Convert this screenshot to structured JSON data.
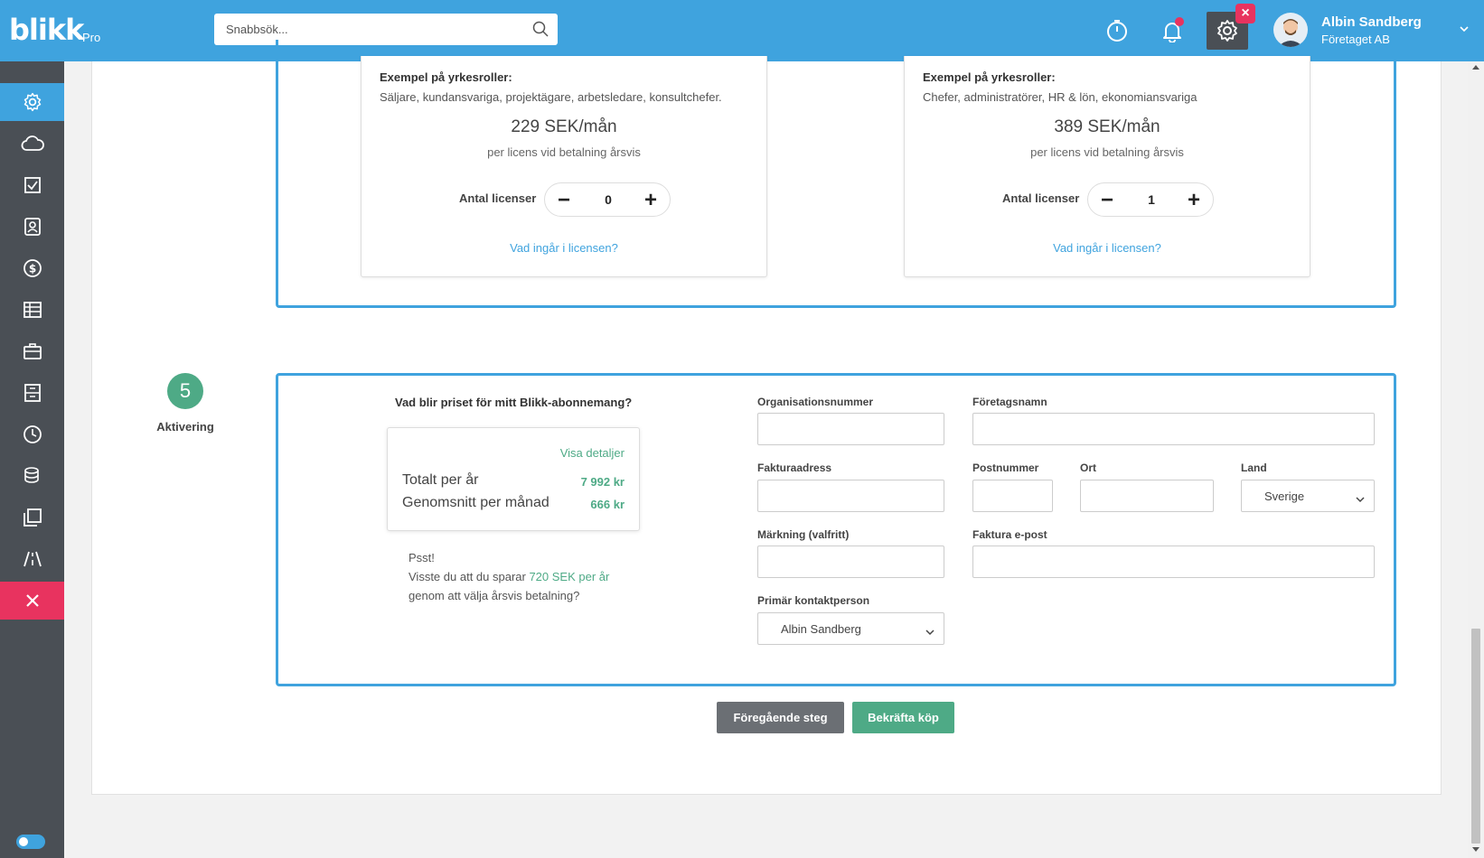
{
  "header": {
    "logo": "blikk",
    "logo_suffix": "Pro",
    "search_placeholder": "Snabbsök...",
    "user_name": "Albin Sandberg",
    "user_company": "Företaget AB",
    "colors": {
      "primary": "#3fa3de",
      "accent": "#e8335f",
      "success": "#4eaa86",
      "sidebar": "#4a4f55"
    }
  },
  "sidebar": {
    "items": [
      {
        "icon": "gear-icon",
        "active": true
      },
      {
        "icon": "cloud-icon"
      },
      {
        "icon": "checkbox-icon"
      },
      {
        "icon": "contacts-icon"
      },
      {
        "icon": "dollar-icon"
      },
      {
        "icon": "table-icon"
      },
      {
        "icon": "briefcase-icon"
      },
      {
        "icon": "archive-icon"
      },
      {
        "icon": "clock-icon"
      },
      {
        "icon": "coins-icon"
      },
      {
        "icon": "copy-icon"
      },
      {
        "icon": "road-icon"
      },
      {
        "icon": "close-icon"
      }
    ]
  },
  "licenses": [
    {
      "roles_title": "Exempel på yrkesroller:",
      "roles_text": "Säljare, kundansvariga, projektägare, arbetsledare, konsultchefer.",
      "price": "229 SEK/mån",
      "price_sub": "per licens vid betalning årsvis",
      "qty_label": "Antal licenser",
      "qty": "0",
      "link": "Vad ingår i licensen?"
    },
    {
      "roles_title": "Exempel på yrkesroller:",
      "roles_text": "Chefer, administratörer, HR & lön, ekonomiansvariga",
      "price": "389 SEK/mån",
      "price_sub": "per licens vid betalning årsvis",
      "qty_label": "Antal licenser",
      "qty": "1",
      "link": "Vad ingår i licensen?"
    }
  ],
  "step": {
    "number": "5",
    "label": "Aktivering"
  },
  "summary": {
    "question": "Vad blir priset för mitt Blikk-abonnemang?",
    "details_link": "Visa detaljer",
    "total_label": "Totalt per år",
    "total_value": "7 992 kr",
    "monthly_label": "Genomsnitt per månad",
    "monthly_value": "666 kr",
    "tip_line1": "Psst!",
    "tip_line2_pre": "Visste du att du sparar ",
    "tip_highlight": "720 SEK per år",
    "tip_line3": "genom att välja årsvis betalning?"
  },
  "form": {
    "org_label": "Organisationsnummer",
    "company_label": "Företagsnamn",
    "address_label": "Fakturaadress",
    "zip_label": "Postnummer",
    "city_label": "Ort",
    "country_label": "Land",
    "country_value": "Sverige",
    "marking_label": "Märkning (valfritt)",
    "email_label": "Faktura e-post",
    "contact_label": "Primär kontaktperson",
    "contact_value": "Albin Sandberg"
  },
  "actions": {
    "prev": "Föregående steg",
    "confirm": "Bekräfta köp"
  }
}
